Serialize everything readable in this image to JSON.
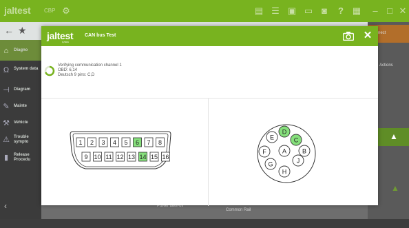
{
  "app": {
    "logo_text": "jaltest",
    "mode_label": "CBP",
    "toolbar_icons": [
      "tractor-icon",
      "document-icon",
      "list-icon",
      "printer-icon",
      "battery-icon",
      "camera-icon",
      "help-icon",
      "grid-icon",
      "minimize-icon",
      "maximize-icon",
      "close-icon"
    ]
  },
  "sidebar": {
    "items": [
      {
        "label": "Diagno",
        "icon": "diagnosis-icon"
      },
      {
        "label": "System data",
        "icon": "omega-icon"
      },
      {
        "label": "Diagram",
        "icon": "diagram-icon"
      },
      {
        "label": "Mainte",
        "icon": "wrench-icon"
      },
      {
        "label": "Vehicle",
        "icon": "vehicle-icon"
      },
      {
        "label": "Trouble sympto",
        "icon": "trouble-icon"
      },
      {
        "label": "Release Procedu",
        "icon": "release-icon"
      }
    ]
  },
  "right_strip": {
    "orange_label": "Connect",
    "actions_label": "Actions"
  },
  "background": {
    "power_takeoff_label": "Power take-off",
    "common_rail_label": "Common Rail"
  },
  "modal": {
    "logo_text": "jaltest",
    "logo_sub": "by TEXA",
    "title": "CAN bus Test",
    "status_lines": [
      "Verifying communication channel 1",
      "OBD: 6,14",
      "Deutsch 9 pins: C,D"
    ],
    "obd": {
      "top_pins": [
        "1",
        "2",
        "3",
        "4",
        "5",
        "6",
        "7",
        "8"
      ],
      "bottom_pins": [
        "9",
        "10",
        "11",
        "12",
        "13",
        "14",
        "15",
        "16"
      ],
      "active_pins": [
        "6",
        "14"
      ]
    },
    "deutsch": {
      "pins": [
        "A",
        "B",
        "C",
        "D",
        "E",
        "F",
        "G",
        "H",
        "J"
      ],
      "active_pins": [
        "C",
        "D"
      ]
    },
    "colors": {
      "accent": "#78b31f",
      "active_pin": "#86e07c"
    }
  }
}
